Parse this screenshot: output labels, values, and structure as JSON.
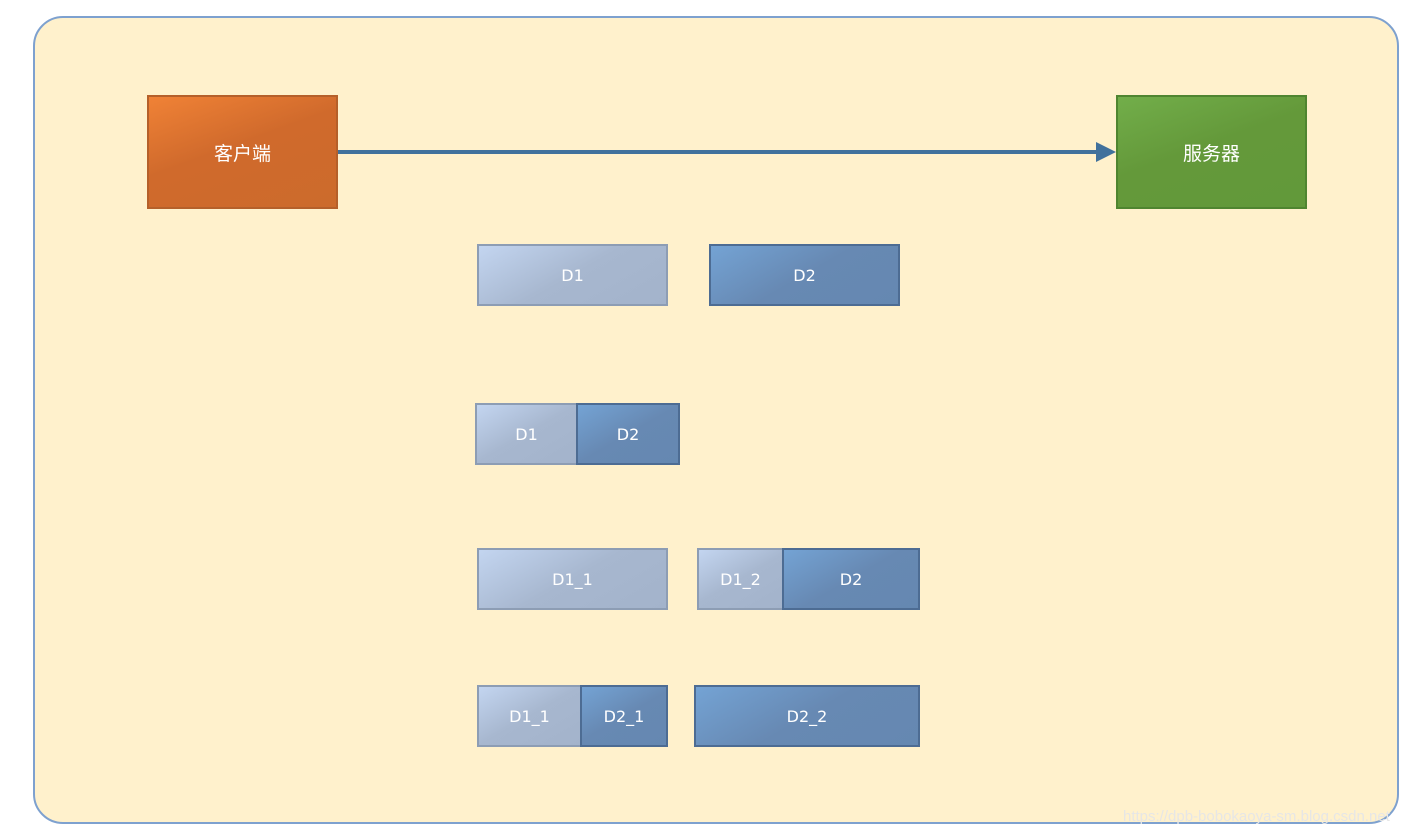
{
  "client": {
    "label": "客户端",
    "color": "#d06a2c"
  },
  "server": {
    "label": "服务器",
    "color": "#64993a"
  },
  "rows": [
    [
      "D1",
      "D2"
    ],
    [
      "D1",
      "D2"
    ],
    [
      "D1_1",
      "D1_2",
      "D2"
    ],
    [
      "D1_1",
      "D2_1",
      "D2_2"
    ]
  ],
  "watermark": "https://dpb-bobokaoya-sm.blog.csdn.net"
}
